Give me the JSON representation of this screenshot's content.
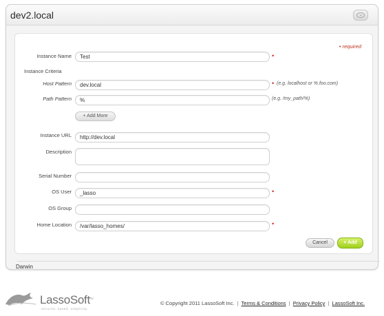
{
  "panel": {
    "title": "dev2.local",
    "collapse_icon": "chevron-down-icon"
  },
  "form": {
    "required_note": "• required",
    "required_marker": "•",
    "instance_name": {
      "label": "Instance Name",
      "value": "Test",
      "required": true
    },
    "criteria_heading": "Instance Criteria",
    "host_pattern": {
      "label": "Host Pattern",
      "value": "dev.local",
      "required": true,
      "hint": "(e.g. localhost or %.foo.com)"
    },
    "path_pattern": {
      "label": "Path Pattern",
      "value": "%",
      "hint": "(e.g. /my_path/%)"
    },
    "add_more_label": "+ Add More",
    "instance_url": {
      "label": "Instance URL",
      "value": "http://dev.local"
    },
    "description": {
      "label": "Description",
      "value": ""
    },
    "serial_number": {
      "label": "Serial Number",
      "value": ""
    },
    "os_user": {
      "label": "OS User",
      "value": "_lasso",
      "required": true
    },
    "os_group": {
      "label": "OS Group",
      "value": ""
    },
    "home_location": {
      "label": "Home Location",
      "value": "/var/lasso_homes/",
      "required": true
    },
    "cancel_label": "Cancel",
    "add_label": "+ Add"
  },
  "footer_section": {
    "label": "Darwin"
  },
  "page_footer": {
    "logo_text": "LassoSoft",
    "logo_inc": "Inc.",
    "tagline": "security. speed. simplicity.",
    "copyright": "© Copyright 2011 LassoSoft Inc.",
    "separator": "|",
    "links": [
      "Terms & Conditions",
      "Privacy Policy",
      "LassoSoft Inc."
    ]
  },
  "colors": {
    "accent_green": "#9fcf1e",
    "required_red": "#d0241a"
  }
}
